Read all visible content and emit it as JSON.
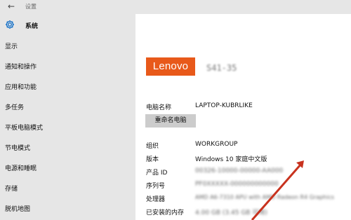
{
  "window": {
    "title": "设置"
  },
  "sidebar": {
    "header": "系统",
    "items": [
      {
        "label": "显示"
      },
      {
        "label": "通知和操作"
      },
      {
        "label": "应用和功能"
      },
      {
        "label": "多任务"
      },
      {
        "label": "平板电脑模式"
      },
      {
        "label": "节电模式"
      },
      {
        "label": "电源和睡眠"
      },
      {
        "label": "存储"
      },
      {
        "label": "脱机地图"
      }
    ]
  },
  "main": {
    "logo_text": "Lenovo",
    "model_text": "S41-35",
    "pc_name": {
      "label": "电脑名称",
      "value": "LAPTOP-KUBRLIKE"
    },
    "rename_button": "重命名电脑",
    "group": {
      "label": "组织",
      "value": "WORKGROUP"
    },
    "version": {
      "label": "版本",
      "value": "Windows 10 家庭中文版"
    },
    "product_id": {
      "label": "产品 ID",
      "value": "00326-10000-00000-AA000"
    },
    "serial": {
      "label": "序列号",
      "value": "PF0XXXXX-000000000000"
    },
    "processor": {
      "label": "处理器",
      "value": "AMD A6-7310 APU with AMD Radeon R4 Graphics"
    },
    "ram": {
      "label": "已安装的内存",
      "value": "4.00 GB (3.45 GB 可用)"
    }
  },
  "colors": {
    "lenovo_red": "#e8591a",
    "annotation_red": "#c8321e",
    "sidebar_bg": "#e6e6e6"
  }
}
